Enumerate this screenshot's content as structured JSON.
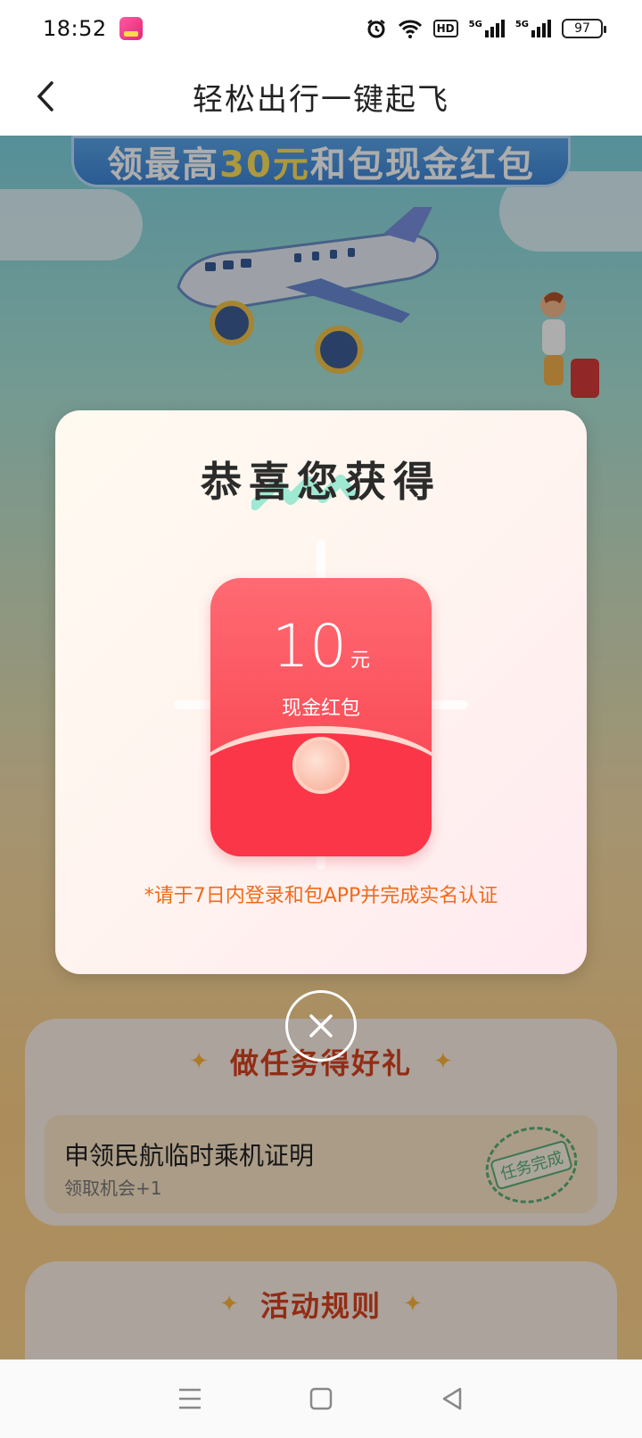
{
  "status_bar": {
    "time": "18:52",
    "battery": "97",
    "hd_label": "HD",
    "net1": "5G",
    "net2": "5G"
  },
  "header": {
    "title": "轻松出行一键起飞",
    "back_icon": "chevron-left-icon"
  },
  "banner": {
    "prefix": "领最高",
    "highlight": "30元",
    "suffix": "和包现金红包"
  },
  "modal": {
    "title": "恭喜您获得",
    "amount": "10",
    "unit": "元",
    "label": "现金红包",
    "note": "*请于7日内登录和包APP并完成实名认证",
    "close_icon": "close-circle-icon"
  },
  "task_card": {
    "heading": "做任务得好礼",
    "task_name": "申领民航临时乘机证明",
    "task_sub": "领取机会+1",
    "stamp": "任务完成"
  },
  "rules_card": {
    "heading": "活动规则"
  },
  "colors": {
    "accent_red": "#f73c4a",
    "note_orange": "#f06a1a",
    "heading_red": "#d9411f"
  }
}
